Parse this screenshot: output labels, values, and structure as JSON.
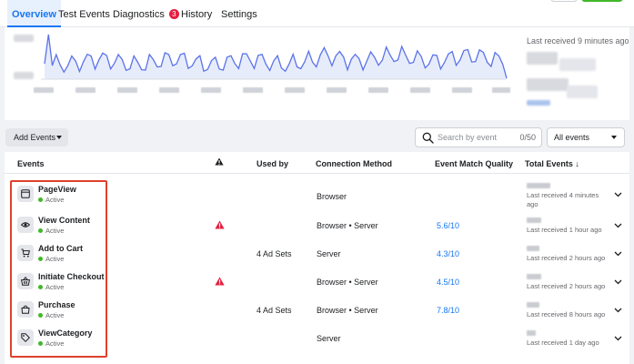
{
  "tabs": [
    {
      "label": "Overview",
      "active": true
    },
    {
      "label": "Test Events",
      "active": false
    },
    {
      "label": "Diagnostics",
      "active": false,
      "badge": "3"
    },
    {
      "label": "History",
      "active": false
    },
    {
      "label": "Settings",
      "active": false
    }
  ],
  "chart": {
    "last_received": "Last received 9 minutes ago",
    "line_color": "#5b73e8",
    "fill_color": "#e7ecfb"
  },
  "toolbar": {
    "add_events_label": "Add Events",
    "search_placeholder": "Search by event",
    "search_count": "0/50",
    "filter_value": "All events"
  },
  "table": {
    "headers": {
      "events": "Events",
      "used_by": "Used by",
      "connection_method": "Connection Method",
      "event_match_quality": "Event Match Quality",
      "total_events": "Total Events ↓"
    },
    "rows": [
      {
        "name": "PageView",
        "status": "Active",
        "icon": "browser-window-icon",
        "warning": false,
        "used_by": "",
        "connection": "Browser",
        "emq": "",
        "last_received": "Last received 4 minutes ago"
      },
      {
        "name": "View Content",
        "status": "Active",
        "icon": "eye-icon",
        "warning": true,
        "used_by": "",
        "connection": "Browser • Server",
        "emq": "5.6/10",
        "last_received": "Last received 1 hour ago"
      },
      {
        "name": "Add to Cart",
        "status": "Active",
        "icon": "cart-icon",
        "warning": false,
        "used_by": "4 Ad Sets",
        "connection": "Server",
        "emq": "4.3/10",
        "last_received": "Last received 2 hours ago"
      },
      {
        "name": "Initiate Checkout",
        "status": "Active",
        "icon": "basket-icon",
        "warning": true,
        "used_by": "",
        "connection": "Browser • Server",
        "emq": "4.5/10",
        "last_received": "Last received 2 hours ago"
      },
      {
        "name": "Purchase",
        "status": "Active",
        "icon": "purchase-bag-icon",
        "warning": false,
        "used_by": "4 Ad Sets",
        "connection": "Browser • Server",
        "emq": "7.8/10",
        "last_received": "Last received 8 hours ago"
      },
      {
        "name": "ViewCategory",
        "status": "Active",
        "icon": "tag-icon",
        "warning": false,
        "used_by": "",
        "connection": "Server",
        "emq": "",
        "last_received": "Last received 1 day ago"
      }
    ]
  },
  "colors": {
    "accent": "#1877f2",
    "active_green": "#42b72a",
    "warning_red": "#e41e3f",
    "highlight_border": "#e0412b"
  }
}
